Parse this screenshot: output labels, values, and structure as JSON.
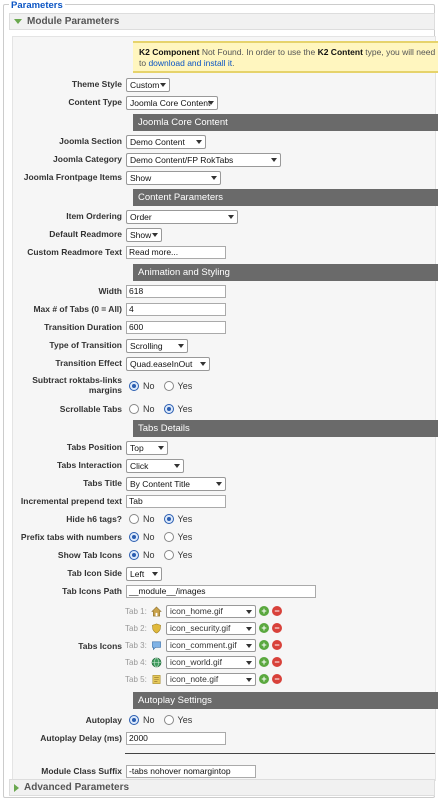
{
  "legend": "Parameters",
  "module_panel_title": "Module Parameters",
  "advanced_panel_title": "Advanced Parameters",
  "notice": {
    "bold1": "K2 Component",
    "text1": " Not Found. In order to use the ",
    "bold2": "K2 Content",
    "text2": " type, you will need to ",
    "link": "download and install it",
    "text3": "."
  },
  "sections": {
    "joomla_core": "Joomla Core Content",
    "content_params": "Content Parameters",
    "animation": "Animation and Styling",
    "tabs_details": "Tabs Details",
    "autoplay": "Autoplay Settings"
  },
  "fields": {
    "theme_style": {
      "label": "Theme Style",
      "value": "Custom"
    },
    "content_type": {
      "label": "Content Type",
      "value": "Joomla Core Content"
    },
    "joomla_section": {
      "label": "Joomla Section",
      "value": "Demo Content"
    },
    "joomla_category": {
      "label": "Joomla Category",
      "value": "Demo Content/FP RokTabs"
    },
    "frontpage_items": {
      "label": "Joomla Frontpage Items",
      "value": "Show"
    },
    "item_ordering": {
      "label": "Item Ordering",
      "value": "Order"
    },
    "default_readmore": {
      "label": "Default Readmore",
      "value": "Show"
    },
    "custom_readmore": {
      "label": "Custom Readmore Text",
      "value": "Read more..."
    },
    "width": {
      "label": "Width",
      "value": "618"
    },
    "max_tabs": {
      "label": "Max # of Tabs (0 = All)",
      "value": "4"
    },
    "transition_duration": {
      "label": "Transition Duration",
      "value": "600"
    },
    "transition_type": {
      "label": "Type of Transition",
      "value": "Scrolling"
    },
    "transition_effect": {
      "label": "Transition Effect",
      "value": "Quad.easeInOut"
    },
    "subtract_margins": {
      "label": "Subtract roktabs-links margins",
      "selected": "No"
    },
    "scrollable_tabs": {
      "label": "Scrollable Tabs",
      "selected": "Yes"
    },
    "tabs_position": {
      "label": "Tabs Position",
      "value": "Top"
    },
    "tabs_interaction": {
      "label": "Tabs Interaction",
      "value": "Click"
    },
    "tabs_title": {
      "label": "Tabs Title",
      "value": "By Content Title"
    },
    "incremental_prepend": {
      "label": "Incremental prepend text",
      "value": "Tab"
    },
    "hide_h6": {
      "label": "Hide h6 tags?",
      "selected": "Yes"
    },
    "prefix_numbers": {
      "label": "Prefix tabs with numbers",
      "selected": "No"
    },
    "show_tab_icons": {
      "label": "Show Tab Icons",
      "selected": "No"
    },
    "tab_icon_side": {
      "label": "Tab Icon Side",
      "value": "Left"
    },
    "tab_icons_path": {
      "label": "Tab Icons Path",
      "value": "__module__/images"
    },
    "tab_icons": {
      "label": "Tabs Icons"
    },
    "autoplay": {
      "label": "Autoplay",
      "selected": "No"
    },
    "autoplay_delay": {
      "label": "Autoplay Delay (ms)",
      "value": "2000"
    },
    "module_class_suffix": {
      "label": "Module Class Suffix",
      "value": "-tabs nohover nomargintop"
    }
  },
  "radio_labels": {
    "no": "No",
    "yes": "Yes"
  },
  "tab_icon_list": [
    {
      "label": "Tab 1:",
      "file": "icon_home.gif",
      "icon": "home-icon",
      "color": "#c9a24a"
    },
    {
      "label": "Tab 2:",
      "file": "icon_security.gif",
      "icon": "shield-icon",
      "color": "#e0b93c"
    },
    {
      "label": "Tab 3:",
      "file": "icon_comment.gif",
      "icon": "comment-icon",
      "color": "#7fb2e5"
    },
    {
      "label": "Tab 4:",
      "file": "icon_world.gif",
      "icon": "globe-icon",
      "color": "#3d9a5c"
    },
    {
      "label": "Tab 5:",
      "file": "icon_note.gif",
      "icon": "note-icon",
      "color": "#e6c95a"
    }
  ],
  "colors": {
    "link": "#0b55c4",
    "section_bg": "#6a6a6a",
    "notice_bg": "#fff6bf",
    "accent": "#6aa84f"
  }
}
